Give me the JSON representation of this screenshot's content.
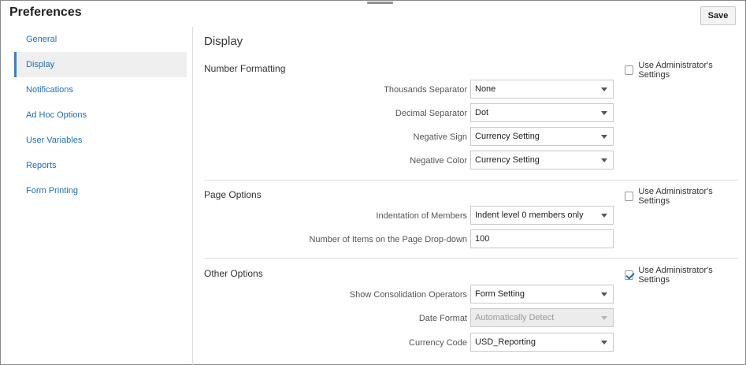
{
  "header": {
    "title": "Preferences",
    "save_label": "Save"
  },
  "sidebar": {
    "items": [
      {
        "label": "General",
        "active": false
      },
      {
        "label": "Display",
        "active": true
      },
      {
        "label": "Notifications",
        "active": false
      },
      {
        "label": "Ad Hoc Options",
        "active": false
      },
      {
        "label": "User Variables",
        "active": false
      },
      {
        "label": "Reports",
        "active": false
      },
      {
        "label": "Form Printing",
        "active": false
      }
    ]
  },
  "main": {
    "title": "Display",
    "sections": [
      {
        "title": "Number Formatting",
        "admin_label": "Use Administrator's Settings",
        "admin_checked": false,
        "rows": [
          {
            "label": "Thousands Separator",
            "value": "None",
            "type": "select",
            "disabled": false
          },
          {
            "label": "Decimal Separator",
            "value": "Dot",
            "type": "select",
            "disabled": false
          },
          {
            "label": "Negative Sign",
            "value": "Currency Setting",
            "type": "select",
            "disabled": false
          },
          {
            "label": "Negative Color",
            "value": "Currency Setting",
            "type": "select",
            "disabled": false
          }
        ]
      },
      {
        "title": "Page Options",
        "admin_label": "Use Administrator's Settings",
        "admin_checked": false,
        "rows": [
          {
            "label": "Indentation of Members",
            "value": "Indent level 0 members only",
            "type": "select",
            "disabled": false
          },
          {
            "label": "Number of Items on the Page Drop-down",
            "value": "100",
            "type": "input",
            "disabled": false
          }
        ]
      },
      {
        "title": "Other Options",
        "admin_label": "Use Administrator's Settings",
        "admin_checked": true,
        "rows": [
          {
            "label": "Show Consolidation Operators",
            "value": "Form Setting",
            "type": "select",
            "disabled": false
          },
          {
            "label": "Date Format",
            "value": "Automatically Detect",
            "type": "select",
            "disabled": true
          },
          {
            "label": "Currency Code",
            "value": "USD_Reporting",
            "type": "select",
            "disabled": false
          }
        ]
      }
    ]
  }
}
